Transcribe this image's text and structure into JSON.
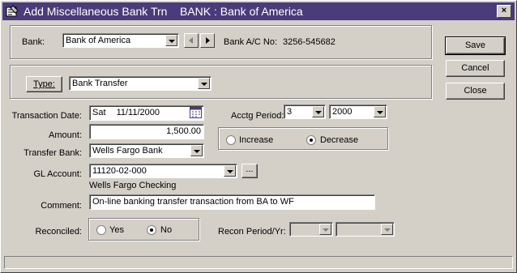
{
  "window": {
    "title": "Add Miscellaneous Bank Trn    BANK : Bank of America",
    "close_glyph": "×",
    "title_bar_color": "#4a3b7a"
  },
  "bank": {
    "label": "Bank:",
    "value": "Bank of America",
    "account_label": "Bank A/C No:",
    "account_number": "3256-545682"
  },
  "type": {
    "button_label": "Type:",
    "value": "Bank Transfer"
  },
  "transaction_date": {
    "label": "Transaction Date:",
    "day": "Sat",
    "date": "11/11/2000"
  },
  "acctg_period": {
    "label": "Acctg Period:",
    "period": "3",
    "year": "2000"
  },
  "amount": {
    "label": "Amount:",
    "value": "1,500.00"
  },
  "direction": {
    "increase_label": "Increase",
    "decrease_label": "Decrease",
    "selected": "Decrease"
  },
  "transfer_bank": {
    "label": "Transfer Bank:",
    "value": "Wells Fargo Bank"
  },
  "gl_account": {
    "label": "GL Account:",
    "value": "11120-02-000",
    "description": "Wells Fargo Checking",
    "lookup_label": "..."
  },
  "comment": {
    "label": "Comment:",
    "value": "On-line banking transfer transaction from BA to WF"
  },
  "reconciled": {
    "label": "Reconciled:",
    "yes_label": "Yes",
    "no_label": "No",
    "selected": "No"
  },
  "recon_period": {
    "label": "Recon Period/Yr:",
    "period": "",
    "year": ""
  },
  "actions": {
    "save": "Save",
    "cancel": "Cancel",
    "close": "Close"
  }
}
